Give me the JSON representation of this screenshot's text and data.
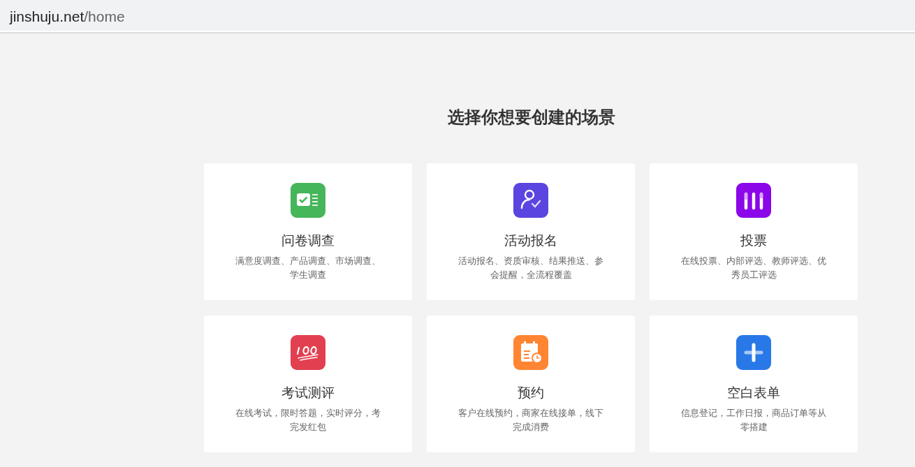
{
  "address_bar": {
    "host": "jinshuju.net",
    "path": "/home"
  },
  "heading": "选择你想要创建的场景",
  "cards": [
    {
      "kind": "survey",
      "color": "#46b65a",
      "title": "问卷调查",
      "description": "满意度调查、产品调查、市场调查、学生调查"
    },
    {
      "kind": "signup",
      "color": "#5b45e0",
      "title": "活动报名",
      "description": "活动报名、资质审核、结果推送、参会提醒，全流程覆盖"
    },
    {
      "kind": "vote",
      "color": "#8b06e8",
      "title": "投票",
      "description": "在线投票、内部评选、教师评选、优秀员工评选"
    },
    {
      "kind": "exam",
      "color": "#e23f51",
      "title": "考试测评",
      "description": "在线考试，限时答题，实时评分，考完发红包"
    },
    {
      "kind": "booking",
      "color": "#ff8533",
      "title": "预约",
      "description": "客户在线预约，商家在线接单，线下完成消费"
    },
    {
      "kind": "blank",
      "color": "#2878e8",
      "title": "空白表单",
      "description": "信息登记，工作日报，商品订单等从零搭建"
    }
  ]
}
